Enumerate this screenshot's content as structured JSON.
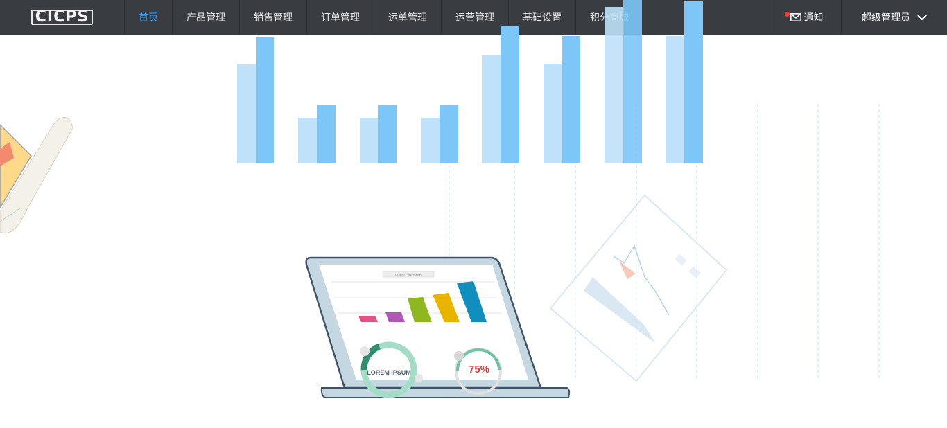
{
  "app": {
    "logo_text": "CICPS"
  },
  "nav": {
    "items": [
      {
        "label": "首页",
        "active": true
      },
      {
        "label": "产品管理",
        "active": false
      },
      {
        "label": "销售管理",
        "active": false
      },
      {
        "label": "订单管理",
        "active": false
      },
      {
        "label": "运单管理",
        "active": false
      },
      {
        "label": "运营管理",
        "active": false
      },
      {
        "label": "基础设置",
        "active": false
      },
      {
        "label": "积分商城",
        "active": false
      }
    ]
  },
  "header_right": {
    "notify_label": "通知",
    "user_label": "超级管理员",
    "mail_icon": "mail-icon",
    "chevron_icon": "chevron-down-icon"
  },
  "illustration": {
    "laptop_chart_title": "Graphic Presentation",
    "donut_label": "LOREM IPSUM",
    "gauge_value": "75%"
  },
  "colors": {
    "topbar": "#393d42",
    "accent": "#3a9bf2",
    "bar_light": "#bfe1fa",
    "bar_dark": "#7cc6f8",
    "notify_dot": "#ff3b30"
  }
}
